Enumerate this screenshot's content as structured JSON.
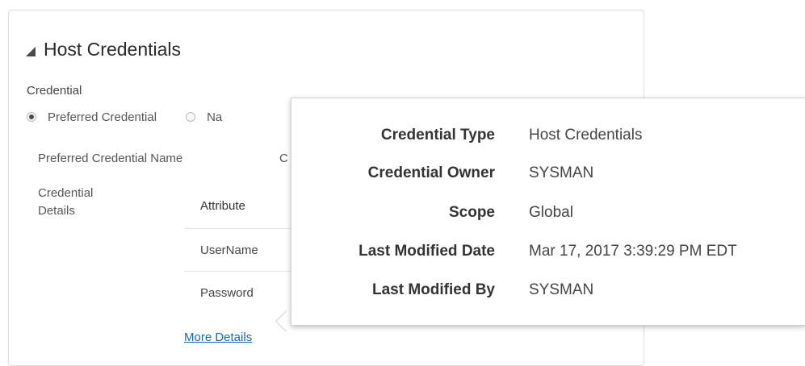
{
  "section": {
    "title": "Host Credentials"
  },
  "credential": {
    "label": "Credential",
    "options": [
      {
        "label": "Preferred Credential",
        "selected": true
      },
      {
        "label": "Na",
        "selected": false
      }
    ],
    "preferred_name_label": "Preferred Credential Name",
    "preferred_name_value": "C",
    "details_label": "Credential Details"
  },
  "attributes": {
    "header": "Attribute",
    "rows": [
      "UserName",
      "Password"
    ]
  },
  "more_details_link": "More Details",
  "popup": {
    "rows": [
      {
        "key": "Credential Type",
        "value": "Host Credentials"
      },
      {
        "key": "Credential Owner",
        "value": "SYSMAN"
      },
      {
        "key": "Scope",
        "value": "Global"
      },
      {
        "key": "Last Modified Date",
        "value": "Mar 17, 2017 3:39:29 PM EDT"
      },
      {
        "key": "Last Modified By",
        "value": "SYSMAN"
      }
    ]
  },
  "colors": {
    "link": "#1a67b3",
    "border": "#dcdcdc"
  },
  "icons": {
    "collapse": "triangle-down-icon"
  }
}
